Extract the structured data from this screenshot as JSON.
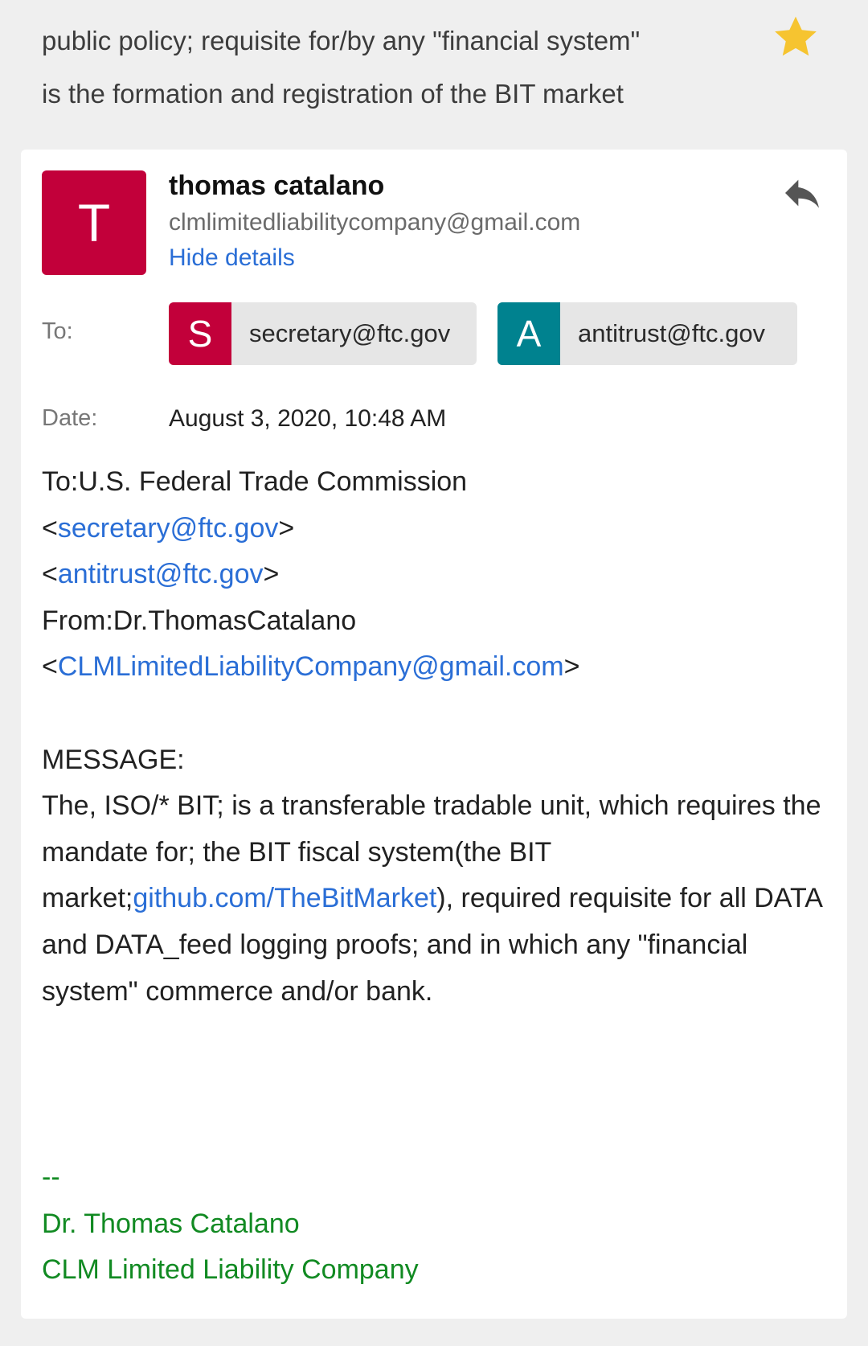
{
  "subject": {
    "line1": "public policy; requisite for/by any \"financial system\"",
    "line2": "is the formation and registration of the BIT market"
  },
  "star_icon": "star-icon",
  "colors": {
    "star": "#f6c430",
    "sender_avatar": "#c2003a",
    "recipient_s_avatar": "#c2003a",
    "recipient_a_avatar": "#00828f",
    "link": "#2a6ed6",
    "signature": "#118a22"
  },
  "sender": {
    "initial": "T",
    "name": "thomas catalano",
    "email": "clmlimitedliabilitycompany@gmail.com",
    "hide_details": "Hide details"
  },
  "reply_icon": "reply-icon",
  "details": {
    "to_label": "To:",
    "date_label": "Date:",
    "date_value": "August 3, 2020, 10:48 AM",
    "recipients": [
      {
        "initial": "S",
        "email": "secretary@ftc.gov"
      },
      {
        "initial": "A",
        "email": "antitrust@ftc.gov"
      }
    ]
  },
  "message": {
    "to_line": "To:U.S. Federal Trade Commission",
    "to_email_1": "secretary@ftc.gov",
    "to_email_2": "antitrust@ftc.gov",
    "from_line": "From:Dr.ThomasCatalano",
    "from_email": "CLMLimitedLiabilityCompany@gmail.com",
    "message_label": "MESSAGE:",
    "para_1": "The, ISO/* BIT; is a transferable tradable unit, which requires the mandate for; the BIT fiscal system(the BIT market;",
    "github_link": "github.com/TheBitMarket",
    "para_2": "), required requisite for all DATA and DATA_feed logging proofs; and in which any \"financial system\" commerce and/or bank."
  },
  "signature": {
    "dashes": "--",
    "name": "Dr. Thomas Catalano",
    "company": "CLM Limited Liability Company"
  }
}
